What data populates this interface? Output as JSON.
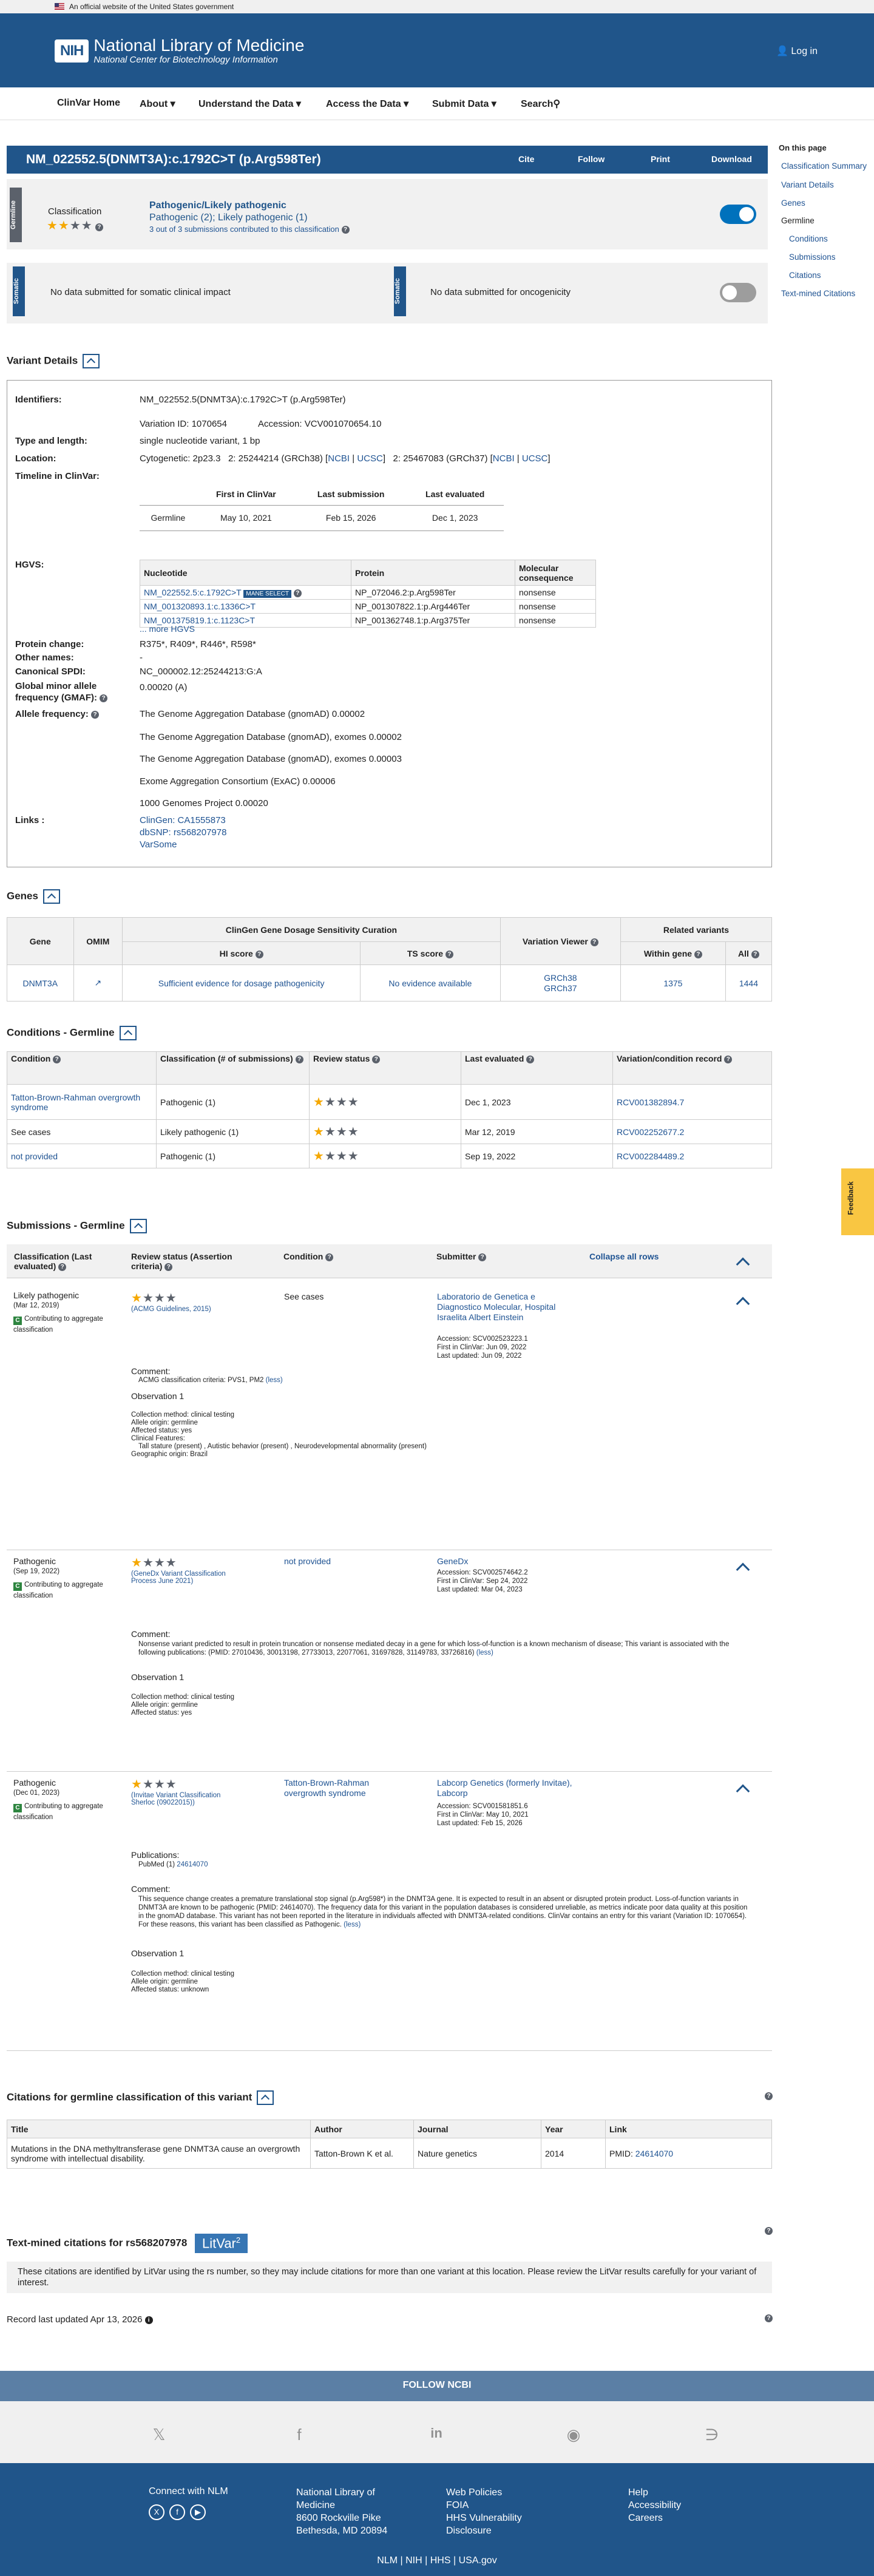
{
  "gov_banner": "An official website of the United States government",
  "header": {
    "logo": "NIH",
    "title": "National Library of Medicine",
    "subtitle": "National Center for Biotechnology Information",
    "login": "Log in"
  },
  "nav": [
    "ClinVar Home",
    "About",
    "Understand the Data",
    "Access the Data",
    "Submit Data",
    "Search"
  ],
  "title": {
    "text": "NM_022552.5(DNMT3A):c.1792C>T (p.Arg598Ter)",
    "buttons": [
      "Cite",
      "Follow",
      "Print",
      "Download"
    ]
  },
  "germline": {
    "tag": "Germline",
    "label": "Classification",
    "classification": "Pathogenic/Likely pathogenic",
    "detail": "Pathogenic (2); Likely pathogenic (1)",
    "submissions": "3 out of 3 submissions contributed to this classification"
  },
  "somatic": {
    "tag": "Somatic",
    "clinical": "No data submitted for somatic clinical impact",
    "onco": "No data submitted for oncogenicity"
  },
  "sidebar": {
    "title": "On this page",
    "items": [
      "Classification Summary",
      "Variant Details",
      "Genes",
      "Germline",
      "Conditions",
      "Submissions",
      "Citations",
      "Text-mined Citations"
    ]
  },
  "variant": {
    "heading": "Variant Details",
    "labels": [
      "Identifiers:",
      "Type and length:",
      "Location:",
      "Timeline in ClinVar:",
      "HGVS:",
      "Protein change:",
      "Other names:",
      "Canonical SPDI:",
      "Global minor allele frequency (GMAF):",
      "Allele frequency:",
      "Links :"
    ],
    "identifier": "NM_022552.5(DNMT3A):c.1792C>T (p.Arg598Ter)",
    "variation_id": "Variation ID: 1070654",
    "accession": "Accession: VCV001070654.10",
    "type": "single nucleotide variant, 1 bp",
    "location": {
      "cyto": "Cytogenetic: 2p23.3",
      "g38": "2: 25244214 (GRCh38) [",
      "g37": "2: 25467083 (GRCh37) [",
      "ncbi": "NCBI",
      "ucsc": "UCSC"
    },
    "timeline": {
      "headers": [
        "First in ClinVar",
        "Last submission",
        "Last evaluated"
      ],
      "row": [
        "Germline",
        "May 10, 2021",
        "Feb 15, 2026",
        "Dec 1, 2023"
      ]
    },
    "hgvs": {
      "headers": [
        "Nucleotide",
        "Protein",
        "Molecular consequence"
      ],
      "mane": "MANE SELECT",
      "rows": [
        [
          "NM_022552.5:c.1792C>T",
          "NP_072046.2:p.Arg598Ter",
          "nonsense"
        ],
        [
          "NM_001320893.1:c.1336C>T",
          "NP_001307822.1:p.Arg446Ter",
          "nonsense"
        ],
        [
          "NM_001375819.1:c.1123C>T",
          "NP_001362748.1:p.Arg375Ter",
          "nonsense"
        ]
      ],
      "more": "... more HGVS"
    },
    "protein_change": "R375*, R409*, R446*, R598*",
    "other_names": "-",
    "spdi": "NC_000002.12:25244213:G:A",
    "gmaf": "0.00020 (A)",
    "freqs": [
      "The Genome Aggregation Database (gnomAD) 0.00002",
      "The Genome Aggregation Database (gnomAD), exomes 0.00002",
      "The Genome Aggregation Database (gnomAD), exomes 0.00003",
      "Exome Aggregation Consortium (ExAC) 0.00006",
      "1000 Genomes Project 0.00020"
    ],
    "links": [
      "ClinGen: CA1555873",
      "dbSNP: rs568207978",
      "VarSome"
    ]
  },
  "genes": {
    "heading": "Genes",
    "curation": "ClinGen Gene Dosage Sensitivity Curation",
    "related": "Related variants",
    "headers": [
      "Gene",
      "OMIM",
      "HI score",
      "TS score",
      "Variation Viewer",
      "Within gene",
      "All"
    ],
    "row": {
      "gene": "DNMT3A",
      "hi": "Sufficient evidence for dosage pathogenicity",
      "ts": "No evidence available",
      "vv1": "GRCh38",
      "vv2": "GRCh37",
      "within": "1375",
      "all": "1444"
    }
  },
  "conditions": {
    "heading": "Conditions - Germline",
    "headers": [
      "Condition",
      "Classification (# of submissions)",
      "Review status",
      "Last evaluated",
      "Variation/condition record"
    ],
    "rows": [
      [
        "Tatton-Brown-Rahman overgrowth syndrome",
        "Pathogenic (1)",
        "Dec 1, 2023",
        "RCV001382894.7"
      ],
      [
        "See cases",
        "Likely pathogenic (1)",
        "Mar 12, 2019",
        "RCV002252677.2"
      ],
      [
        "not provided",
        "Pathogenic (1)",
        "Sep 19, 2022",
        "RCV002284489.2"
      ]
    ]
  },
  "submissions": {
    "heading": "Submissions - Germline",
    "headers": [
      "Classification (Last evaluated)",
      "Review status (Assertion criteria)",
      "Condition",
      "Submitter"
    ],
    "collapse": "Collapse all rows",
    "contributing": "Contributing to aggregate classification",
    "comment": "Comment:",
    "observation": "Observation 1",
    "s1": {
      "cls": "Likely pathogenic",
      "date": "(Mar 12, 2019)",
      "criteria": "(ACMG Guidelines, 2015)",
      "condition": "See cases",
      "submitter": "Laboratorio de Genetica e Diagnostico Molecular, Hospital Israelita Albert Einstein",
      "meta": [
        "Accession: SCV002523223.1",
        "First in ClinVar: Jun 09, 2022",
        "Last updated: Jun 09, 2022"
      ],
      "comment": "ACMG classification criteria: PVS1, PM2",
      "less": "(less)",
      "obs": [
        "Collection method: clinical testing",
        "Allele origin: germline",
        "Affected status: yes",
        "Clinical Features:",
        "Tall stature (present) , Autistic behavior (present) , Neurodevelopmental abnormality (present)",
        "Geographic origin: Brazil"
      ]
    },
    "s2": {
      "cls": "Pathogenic",
      "date": "(Sep 19, 2022)",
      "criteria": "(GeneDx Variant Classification Process June 2021)",
      "condition": "not provided",
      "submitter": "GeneDx",
      "meta": [
        "Accession: SCV002574642.2",
        "First in ClinVar: Sep 24, 2022",
        "Last updated: Mar 04, 2023"
      ],
      "comment": "Nonsense variant predicted to result in protein truncation or nonsense mediated decay in a gene for which loss-of-function is a known mechanism of disease; This variant is associated with the following publications: (PMID: 27010436, 30013198, 27733013, 22077061, 31697828, 31149783, 33726816)",
      "less": "(less)",
      "obs": [
        "Collection method: clinical testing",
        "Allele origin: germline",
        "Affected status: yes"
      ]
    },
    "s3": {
      "cls": "Pathogenic",
      "date": "(Dec 01, 2023)",
      "criteria": "(Invitae Variant Classification Sherloc (09022015))",
      "condition": "Tatton-Brown-Rahman overgrowth syndrome",
      "submitter": "Labcorp Genetics (formerly Invitae), Labcorp",
      "meta": [
        "Accession: SCV001581851.6",
        "First in ClinVar: May 10, 2021",
        "Last updated: Feb 15, 2026"
      ],
      "pubs": "Publications:",
      "pubmed": "PubMed (1)",
      "pubmed_link": "24614070",
      "comment": "This sequence change creates a premature translational stop signal (p.Arg598*) in the DNMT3A gene. It is expected to result in an absent or disrupted protein product. Loss-of-function variants in DNMT3A are known to be pathogenic (PMID: 24614070). The frequency data for this variant in the population databases is considered unreliable, as metrics indicate poor data quality at this position in the gnomAD database. This variant has not been reported in the literature in individuals affected with DNMT3A-related conditions. ClinVar contains an entry for this variant (Variation ID: 1070654). For these reasons, this variant has been classified as Pathogenic.",
      "less": "(less)",
      "obs": [
        "Collection method: clinical testing",
        "Allele origin: germline",
        "Affected status: unknown"
      ]
    }
  },
  "citations": {
    "heading": "Citations for germline classification of this variant",
    "headers": [
      "Title",
      "Author",
      "Journal",
      "Year",
      "Link"
    ],
    "row": {
      "title": "Mutations in the DNA methyltransferase gene DNMT3A cause an overgrowth syndrome with intellectual disability.",
      "author": "Tatton-Brown K et al.",
      "journal": "Nature genetics",
      "year": "2014",
      "pmid": "PMID:",
      "link": "24614070"
    }
  },
  "textmined": {
    "heading": "Text-mined citations for rs568207978",
    "litvar": "LitVar",
    "sup": "2",
    "note": "These citations are identified by LitVar using the rs number, so they may include citations for more than one variant at this location. Please review the LitVar results carefully for your variant of interest."
  },
  "updated": "Record last updated Apr 13, 2026",
  "footer": {
    "follow": "FOLLOW NCBI",
    "connect": "Connect with NLM",
    "address": [
      "National Library of",
      "Medicine",
      "8600 Rockville Pike",
      "Bethesda, MD 20894"
    ],
    "col2": [
      "Web Policies",
      "FOIA",
      "HHS Vulnerability",
      "Disclosure"
    ],
    "col3": [
      "Help",
      "Accessibility",
      "Careers"
    ],
    "bottom": [
      "NLM",
      "NIH",
      "HHS",
      "USA.gov"
    ]
  },
  "feedback": "Feedback"
}
